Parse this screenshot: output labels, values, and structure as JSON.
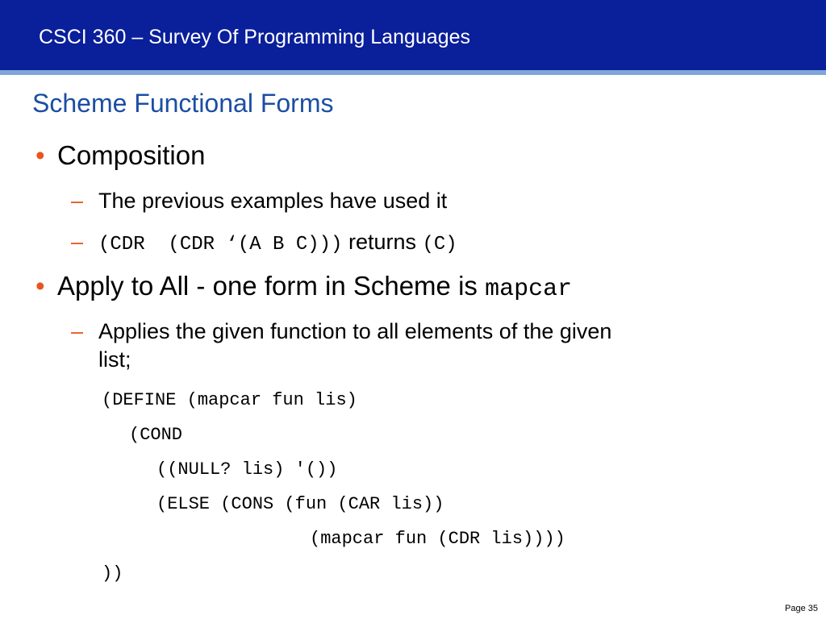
{
  "header": {
    "course_title": "CSCI 360 – Survey Of Programming Languages"
  },
  "slide": {
    "title": "Scheme Functional Forms",
    "bullet_glyph": "•",
    "dash_glyph": "–",
    "bullets": [
      {
        "text": "Composition",
        "subs": [
          {
            "text": "The previous examples have used it"
          },
          {
            "code_a": "(CDR  (CDR ‘(A B C)))",
            "text": " returns ",
            "code_b": "(C)"
          }
        ]
      },
      {
        "text": "Apply to All - one form in Scheme is ",
        "code": "mapcar",
        "subs": [
          {
            "line1": "Applies the given function to all elements of the given",
            "line2": "list;"
          }
        ]
      }
    ],
    "code_lines": [
      "(DEFINE (mapcar fun lis)",
      "(COND",
      "((NULL? lis) '())",
      "(ELSE (CONS (fun (CAR lis))",
      "(mapcar fun (CDR lis))))",
      "))"
    ]
  },
  "footer": {
    "page_label": "Page 35"
  },
  "colors": {
    "header_bg": "#0a1f9a",
    "header_rule": "#7fa6d8",
    "title": "#1b4ea3",
    "bullet_accent": "#e8551c"
  }
}
